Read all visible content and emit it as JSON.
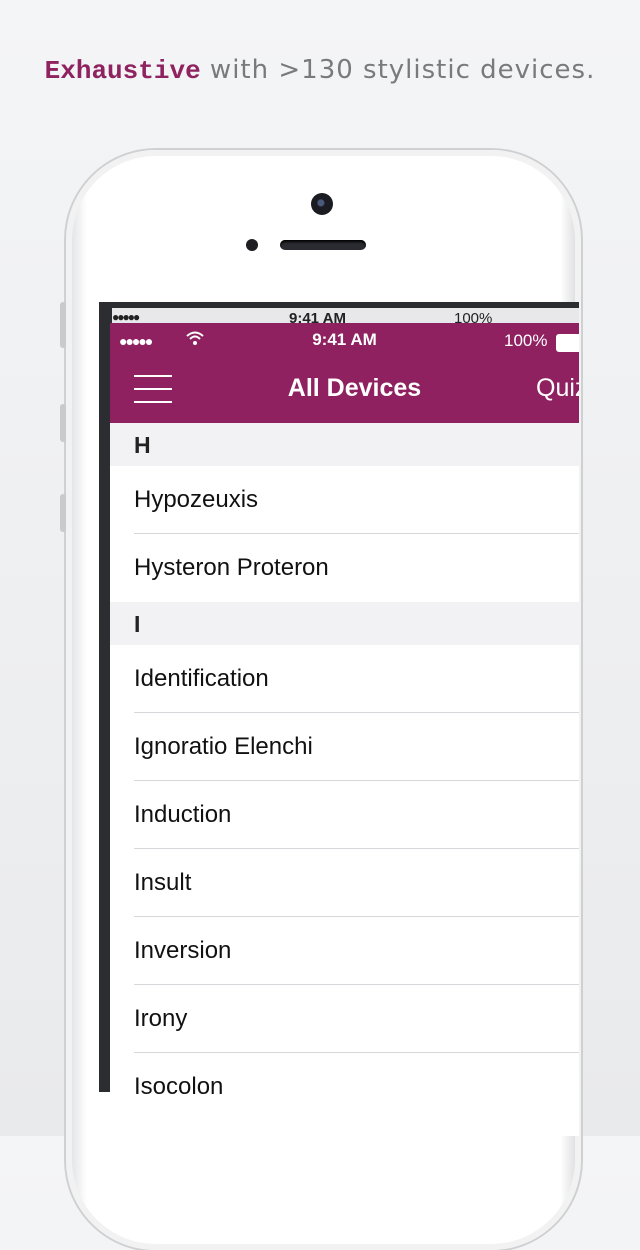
{
  "headline": {
    "strong": "Exhaustive",
    "rest": " with >130 stylistic devices."
  },
  "status_bar": {
    "signal": "●●●●●",
    "time": "9:41 AM",
    "battery": "100%"
  },
  "ghost_status_bar": {
    "signal": "●●●●●",
    "time": "9:41 AM",
    "battery": "100%"
  },
  "navbar": {
    "title": "All Devices",
    "right_button": "Quiz",
    "menu_icon": "hamburger-icon",
    "color": "#8f2161"
  },
  "list": {
    "sections": [
      {
        "header": "H",
        "items": [
          "Hypozeuxis",
          "Hysteron Proteron"
        ]
      },
      {
        "header": "I",
        "items": [
          "Identification",
          "Ignoratio Elenchi",
          "Induction",
          "Insult",
          "Inversion",
          "Irony",
          "Isocolon"
        ]
      }
    ]
  },
  "accent_color": "#8e2360"
}
